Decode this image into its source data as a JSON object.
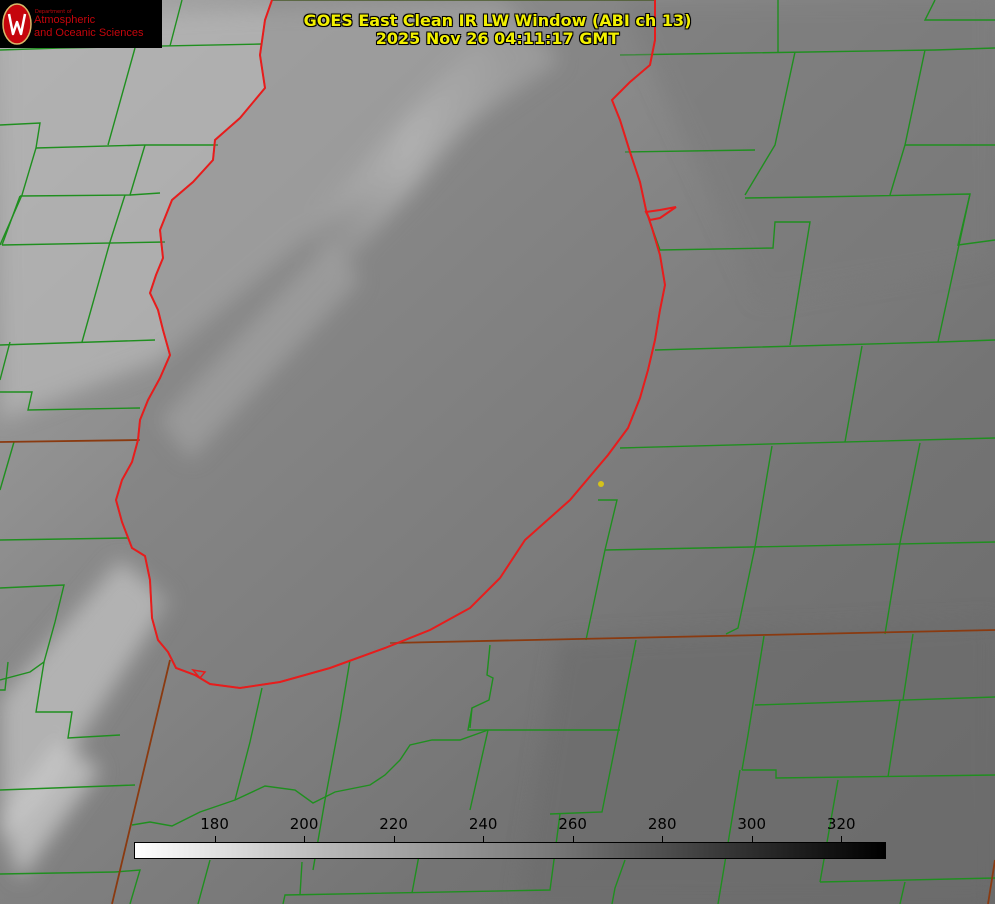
{
  "title": {
    "line1": "GOES East Clean IR LW Window (ABI ch 13)",
    "line2": "2025 Nov 26 04:11:17 GMT"
  },
  "logo": {
    "department": "Department of",
    "line1": "Atmospheric",
    "line2": "and Oceanic Sciences",
    "seal_icon": "uw-crest-icon"
  },
  "colorbar": {
    "ticks": [
      "180",
      "200",
      "220",
      "240",
      "260",
      "280",
      "300",
      "320"
    ],
    "range": [
      162,
      330
    ],
    "colors": [
      "#ffffff",
      "#000000"
    ]
  },
  "map": {
    "county_line_color": "#1f8f1f",
    "state_line_color": "#8a3a10",
    "lake_outline_color": "#e81c1c",
    "station_marker_color": "#d4c21a"
  }
}
